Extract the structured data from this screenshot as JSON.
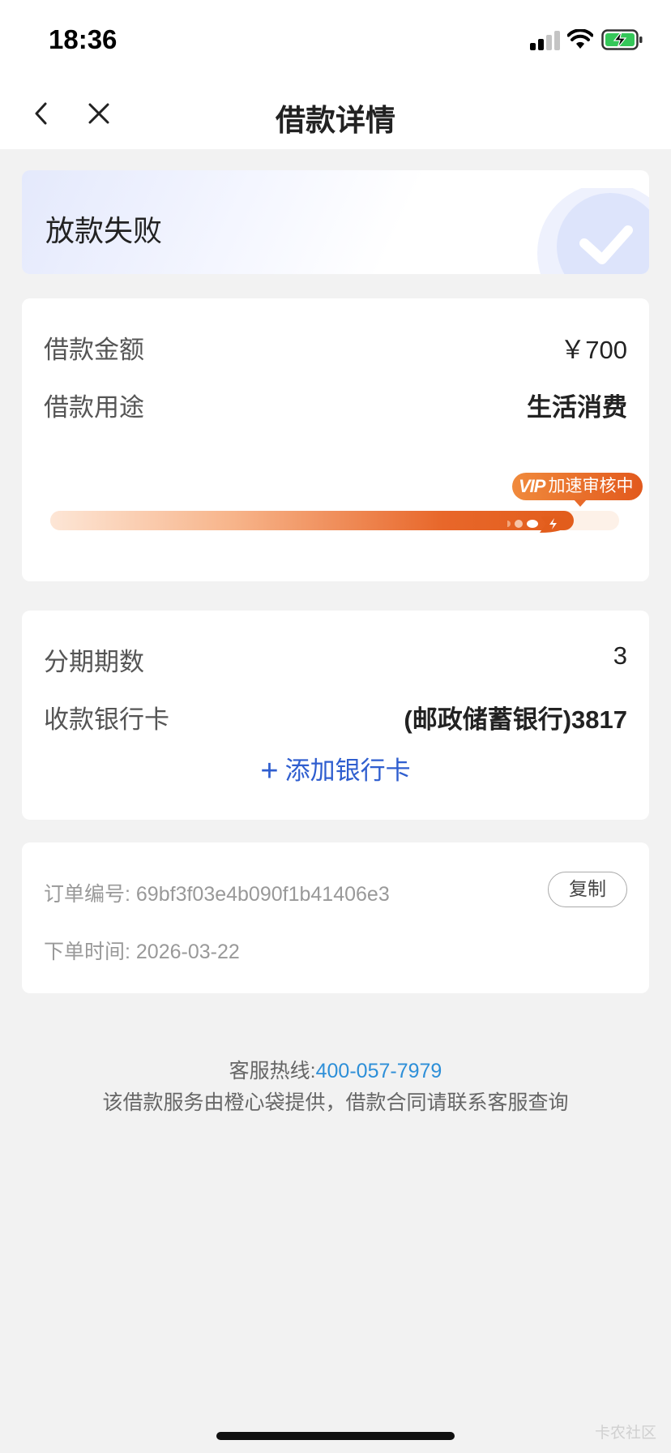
{
  "status_bar": {
    "time": "18:36"
  },
  "nav": {
    "title": "借款详情"
  },
  "status": {
    "title": "放款失败"
  },
  "loan": {
    "amount_label": "借款金额",
    "amount_value": "￥700",
    "purpose_label": "借款用途",
    "purpose_value": "生活消费",
    "progress": 0.92,
    "vip_prefix": "VIP",
    "vip_text": "加速审核中"
  },
  "installment": {
    "periods_label": "分期期数",
    "periods_value": "3",
    "bank_label": "收款银行卡",
    "bank_value": "(邮政储蓄银行)3817",
    "add_card_label": "添加银行卡"
  },
  "order": {
    "number_label": "订单编号:",
    "number_value": "69bf3f03e4b090f1b41406e3",
    "copy_label": "复制",
    "time_label": "下单时间:",
    "time_value": "2026-03-22"
  },
  "footer": {
    "hotline_label": "客服热线:",
    "hotline_number": "400-057-7979",
    "note": "该借款服务由橙心袋提供，借款合同请联系客服查询"
  },
  "watermark": "卡农社区",
  "colors": {
    "accent_blue": "#2f5ecf",
    "hotline_blue": "#2d8fd8",
    "vip_orange": "#e2591d"
  }
}
